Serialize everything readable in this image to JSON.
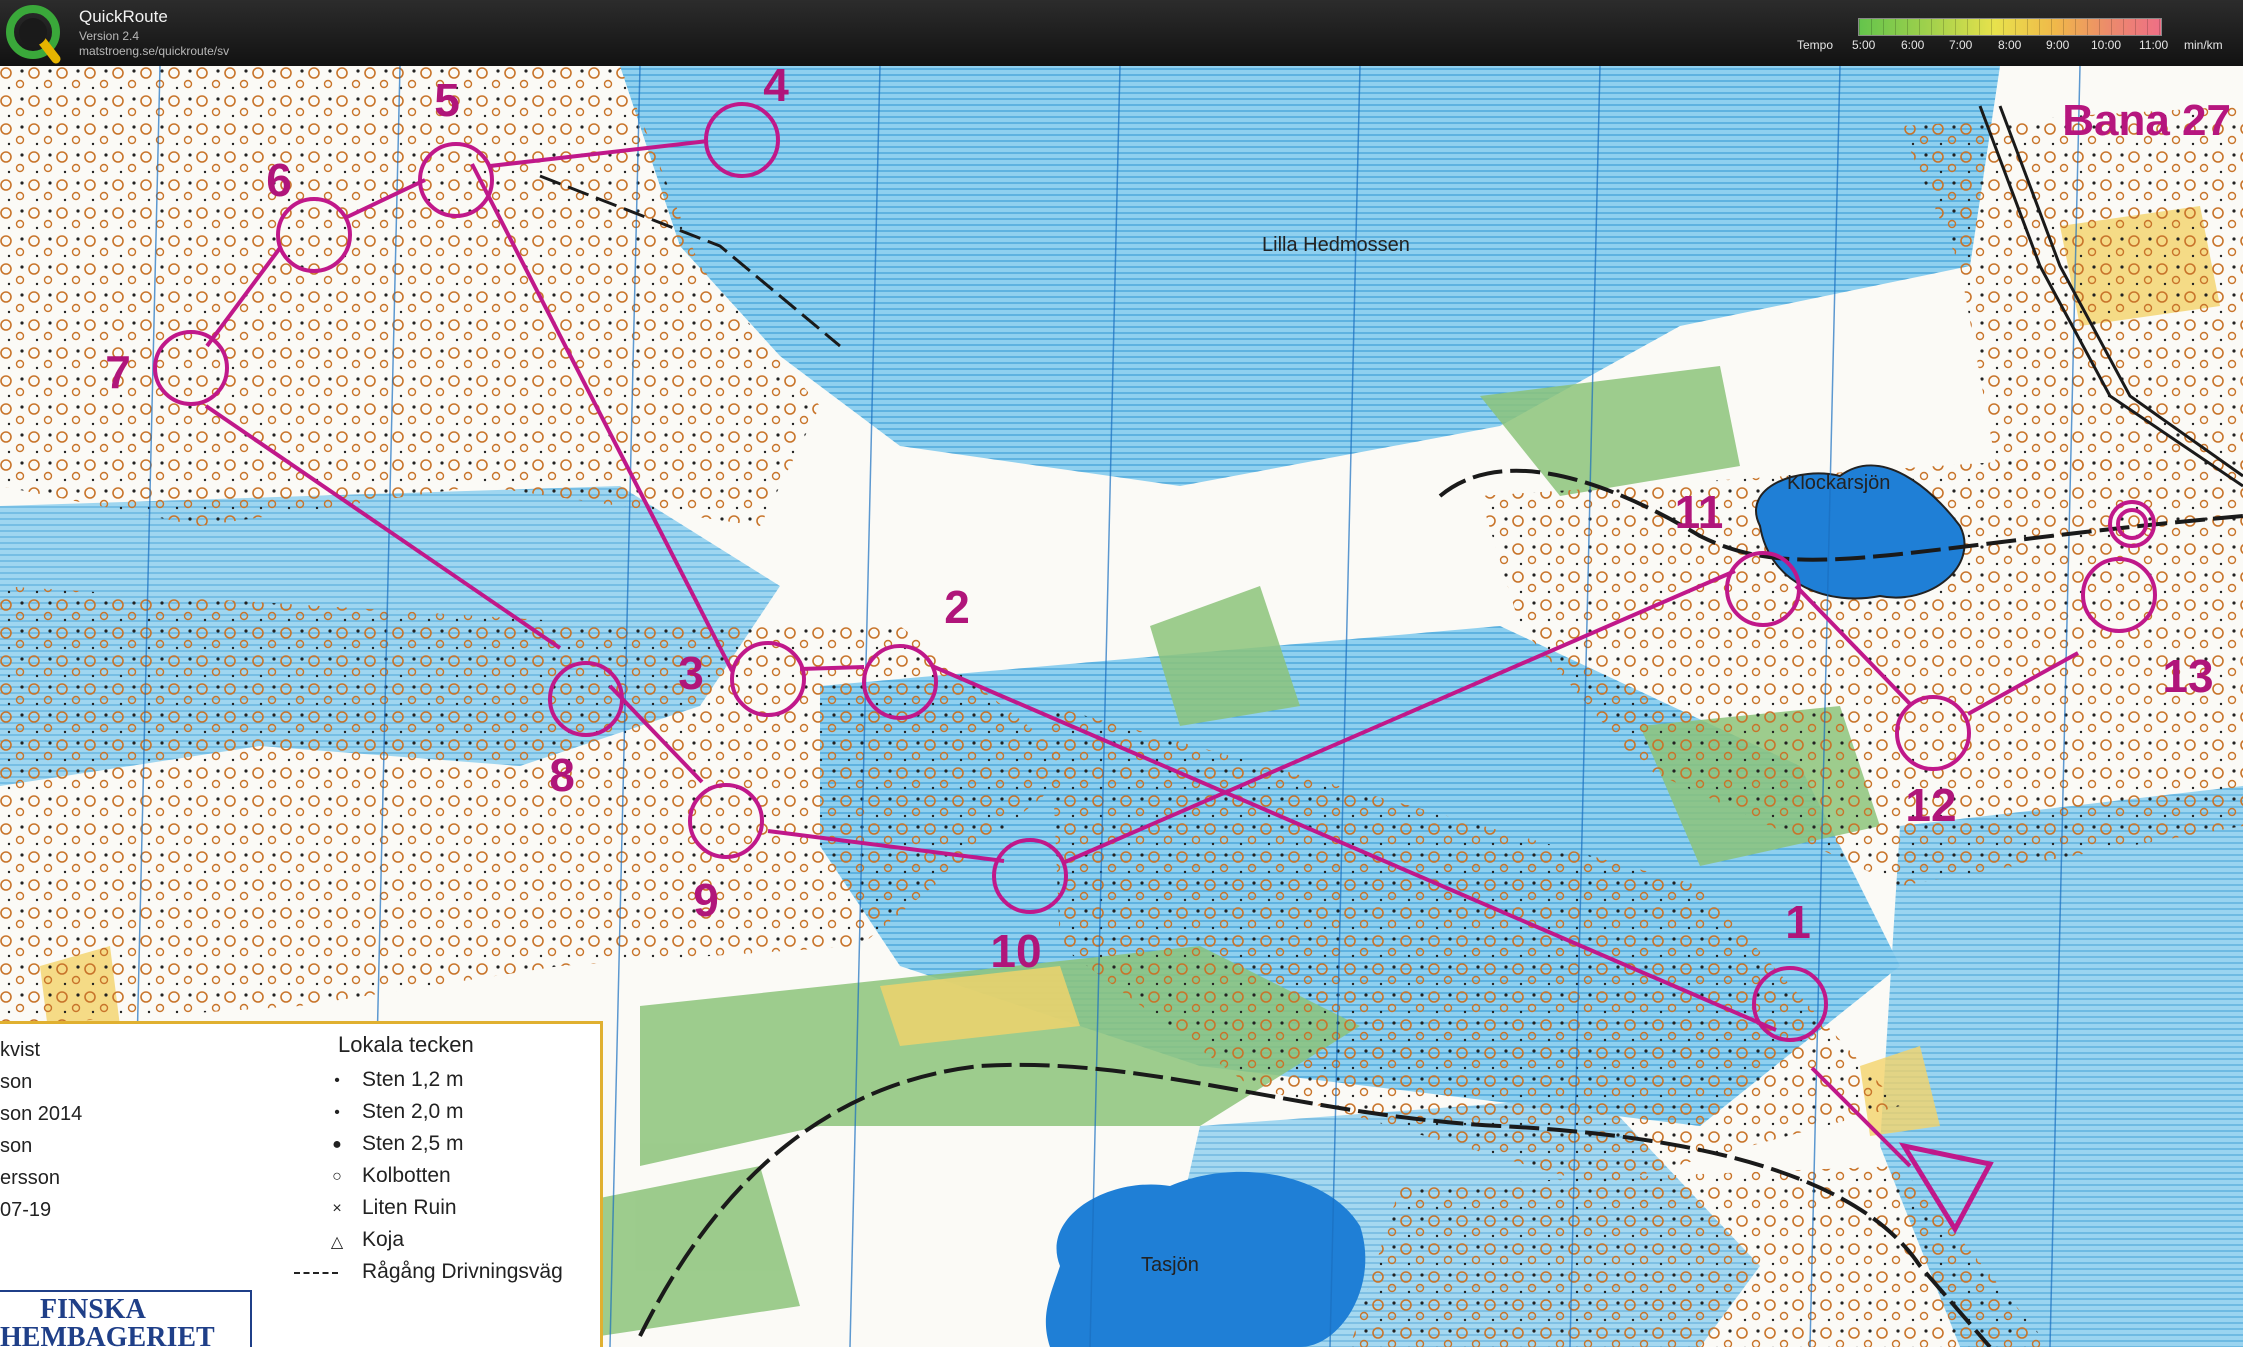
{
  "app": {
    "title": "QuickRoute",
    "version": "Version 2.4",
    "url": "matstroeng.se/quickroute/sv"
  },
  "tempo": {
    "label": "Tempo",
    "ticks": [
      "5:00",
      "6:00",
      "7:00",
      "8:00",
      "9:00",
      "10:00",
      "11:00"
    ],
    "unit": "min/km",
    "colors": [
      "#64c44c",
      "#e8e24c",
      "#ee6f86"
    ]
  },
  "map": {
    "course_title": "Bana 27",
    "places": [
      "Lilla Hedmossen",
      "Klockarsjön",
      "Tasjön"
    ],
    "controls": [
      "1",
      "2",
      "3",
      "4",
      "5",
      "6",
      "7",
      "8",
      "9",
      "10",
      "11",
      "12",
      "13"
    ],
    "colors": {
      "course": "#c0188a",
      "water": "#5ab4e6",
      "open": "#f4d36a",
      "contour": "#c8742a",
      "green": "#8cc37a"
    }
  },
  "legend": {
    "credits": [
      "kvist",
      "son",
      "son  2014",
      "son",
      "ersson",
      "07-19"
    ],
    "title": "Lokala tecken",
    "items": [
      {
        "symbol": "•",
        "label": "Sten 1,2 m"
      },
      {
        "symbol": "•",
        "label": "Sten 2,0 m"
      },
      {
        "symbol": "●",
        "label": "Sten 2,5 m"
      },
      {
        "symbol": "○",
        "label": "Kolbotten"
      },
      {
        "symbol": "×",
        "label": "Liten Ruin"
      },
      {
        "symbol": "△",
        "label": "Koja"
      },
      {
        "symbol": "",
        "label": "Rågång Drivningsväg"
      }
    ]
  },
  "sponsor": {
    "line1": "FINSKA",
    "line2": "HEMBAGERIET"
  }
}
